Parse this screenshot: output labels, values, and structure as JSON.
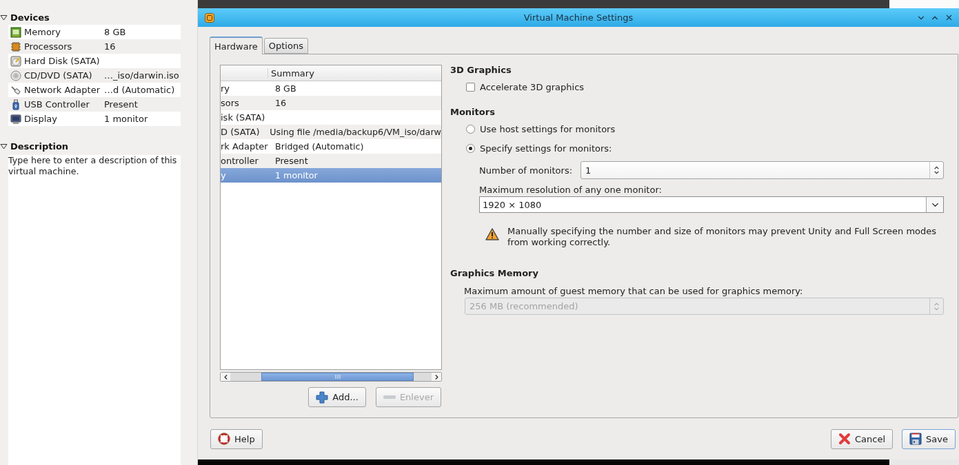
{
  "sidebar": {
    "devices": {
      "title": "Devices",
      "expanded": true,
      "items": [
        {
          "kind": "memory",
          "name": "Memory",
          "value": "8 GB"
        },
        {
          "kind": "processor",
          "name": "Processors",
          "value": "16"
        },
        {
          "kind": "disk",
          "name": "Hard Disk (SATA)"
        },
        {
          "kind": "cd",
          "name": "CD/DVD (SATA)",
          "value": "…_iso/darwin.iso"
        },
        {
          "kind": "network",
          "name": "Network Adapter",
          "value": "…d (Automatic)"
        },
        {
          "kind": "usb",
          "name": "USB Controller",
          "value": "Present"
        },
        {
          "kind": "display",
          "name": "Display",
          "value": "1 monitor"
        }
      ]
    },
    "description": {
      "title": "Description",
      "expanded": true,
      "placeholder": "Type here to enter a description of this virtual machine."
    }
  },
  "dialog": {
    "title": "Virtual Machine Settings",
    "tabs": [
      {
        "label": "Hardware",
        "selected": true
      },
      {
        "label": "Options",
        "selected": false
      }
    ],
    "device_table": {
      "columns": [
        "Summary"
      ],
      "rows": [
        {
          "column_1": "ry",
          "summary": "8 GB",
          "selected": false
        },
        {
          "column_1": "sors",
          "summary": "16",
          "selected": false
        },
        {
          "column_1": "isk (SATA)",
          "selected": false
        },
        {
          "column_1": "D (SATA)",
          "summary": "Using file /media/backup6/VM_iso/darw",
          "selected": false
        },
        {
          "column_1": "rk Adapter",
          "summary": "Bridged (Automatic)",
          "selected": false
        },
        {
          "column_1": "ontroller",
          "summary": "Present",
          "selected": false
        },
        {
          "column_1": "y",
          "summary": "1 monitor",
          "selected": true
        }
      ]
    },
    "table_buttons": [
      {
        "kind": "add",
        "label": "Add...",
        "disabled": false
      },
      {
        "kind": "remove",
        "label": "Enlever",
        "disabled": true
      }
    ],
    "graphics_3d": {
      "heading": "3D Graphics",
      "accelerate": {
        "label": "Accelerate 3D graphics",
        "checked": false
      }
    },
    "monitors": {
      "heading": "Monitors",
      "options": [
        {
          "label": "Use host settings for monitors",
          "selected": false
        },
        {
          "label": "Specify settings for monitors:",
          "selected": true
        }
      ],
      "count_label": "Number of monitors:",
      "count_value": "1",
      "resolution_label": "Maximum resolution of any one monitor:",
      "resolution_value": "1920 × 1080",
      "warning": "Manually specifying the number and size of monitors may prevent Unity and Full Screen modes from working correctly."
    },
    "graphics_memory": {
      "heading": "Graphics Memory",
      "label": "Maximum amount of guest memory that can be used for graphics memory:",
      "value": "256 MB (recommended)",
      "disabled": true
    },
    "footer": {
      "help": "Help",
      "cancel": "Cancel",
      "save": "Save"
    }
  }
}
